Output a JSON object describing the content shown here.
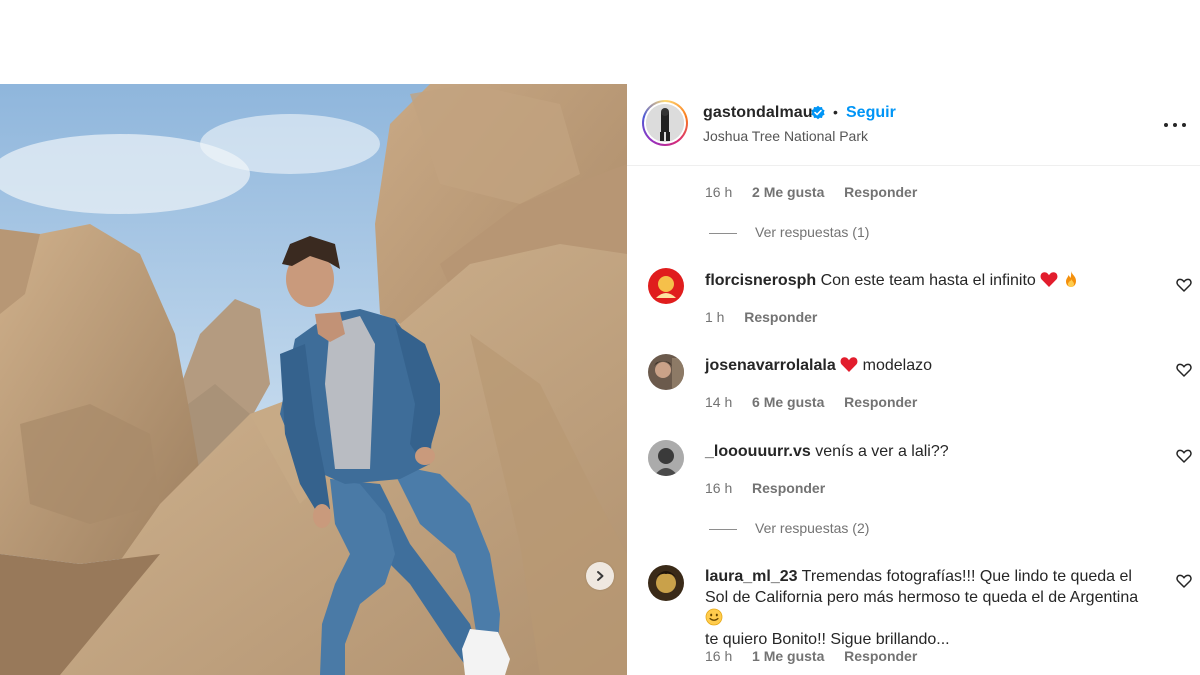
{
  "post": {
    "username": "gastondalmau",
    "follow_label": "Seguir",
    "separator": "•",
    "location": "Joshua Tree National Park",
    "icons": {
      "verified": "verified-badge-icon",
      "more": "more-options-icon",
      "next": "carousel-next-icon"
    },
    "colors": {
      "accent": "#0095f6",
      "text": "#262626",
      "muted": "#737373",
      "heart": "#ed4956"
    }
  },
  "thread": {
    "top_meta": {
      "time": "16 h",
      "likes": "2 Me gusta",
      "reply": "Responder"
    },
    "top_view_replies": "Ver respuestas (1)",
    "comments": [
      {
        "user": "florcisnerosph",
        "text": "Con este team hasta el infinito",
        "emoji": [
          "red-heart-icon",
          "fire-icon"
        ],
        "time": "1 h",
        "likes": "",
        "reply": "Responder"
      },
      {
        "user": "josenavarrolalala",
        "text_before_emoji": "",
        "emoji": [
          "red-heart-icon"
        ],
        "text": "modelazo",
        "time": "14 h",
        "likes": "6 Me gusta",
        "reply": "Responder"
      },
      {
        "user": "_looouuurr.vs",
        "text": "venís a ver a lali??",
        "time": "16 h",
        "likes": "",
        "reply": "Responder",
        "view_replies": "Ver respuestas (2)"
      },
      {
        "user": "laura_ml_23",
        "text": "Tremendas fotografías!!! Que lindo te queda el Sol de California pero más hermoso te queda el de Argentina",
        "text_after_emoji": "te quiero Bonito!! Sigue brillando...",
        "emoji": [
          "smiling-face-icon"
        ],
        "time": "16 h",
        "likes": "1 Me gusta",
        "reply": "Responder"
      }
    ]
  }
}
